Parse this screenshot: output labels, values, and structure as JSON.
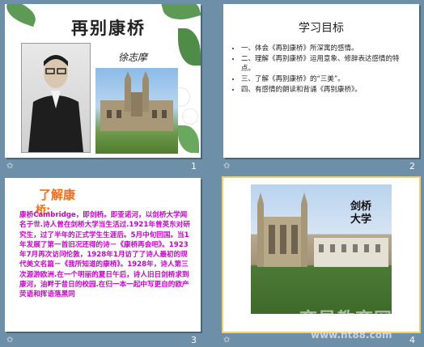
{
  "window": {
    "view": "Slide Sorter"
  },
  "slides": [
    {
      "number": "1",
      "title": "再别康桥",
      "author": "徐志摩"
    },
    {
      "number": "2",
      "heading": "学习目标",
      "items": [
        "一、体会《再别康桥》所深寓的感情。",
        "二、理解《再别康桥》运用意象、修辞表达感情的特点。",
        "三、了解《再别康桥》的“三美”。",
        "四、有感情的朗读和背诵《再别康桥》。"
      ]
    },
    {
      "number": "3",
      "heading": "了解康",
      "heading_line2": "桥:",
      "body": "康桥Cambridge，即剑桥。即亚诺河，以剑桥大学闻名于世.诗人曾在剑桥大学当生活过.1921年曾英东对研究生，过了半年的正式学生生涯后。5月中旬回国。当1年发展了第一首旧况还得的诗－《康桥再会吧》。1923年7月再次访问伦敦，1928年1月访了了诗人最初的现代美文名篇－《我所知道的康桥》。1928年，诗人第三次源游欧洲.在一个明丽的夏日午后，诗人旧日剑桥求到康河，油畔于昔日的校园.在归一本一起中写更自的欧产荧语和挥语落黑同"
    },
    {
      "number": "4",
      "caption_line1": "剑桥",
      "caption_line2": "大学"
    }
  ],
  "slide_icon": "star-transition-icon",
  "watermark": {
    "text": "育星教育网",
    "url": "www.ht88.com"
  },
  "colors": {
    "sorter_background": "#6e8fa8",
    "selection_outline": "#f3d06a",
    "s3_heading": "#ff6a10",
    "s3_body": "#cc00cc"
  }
}
